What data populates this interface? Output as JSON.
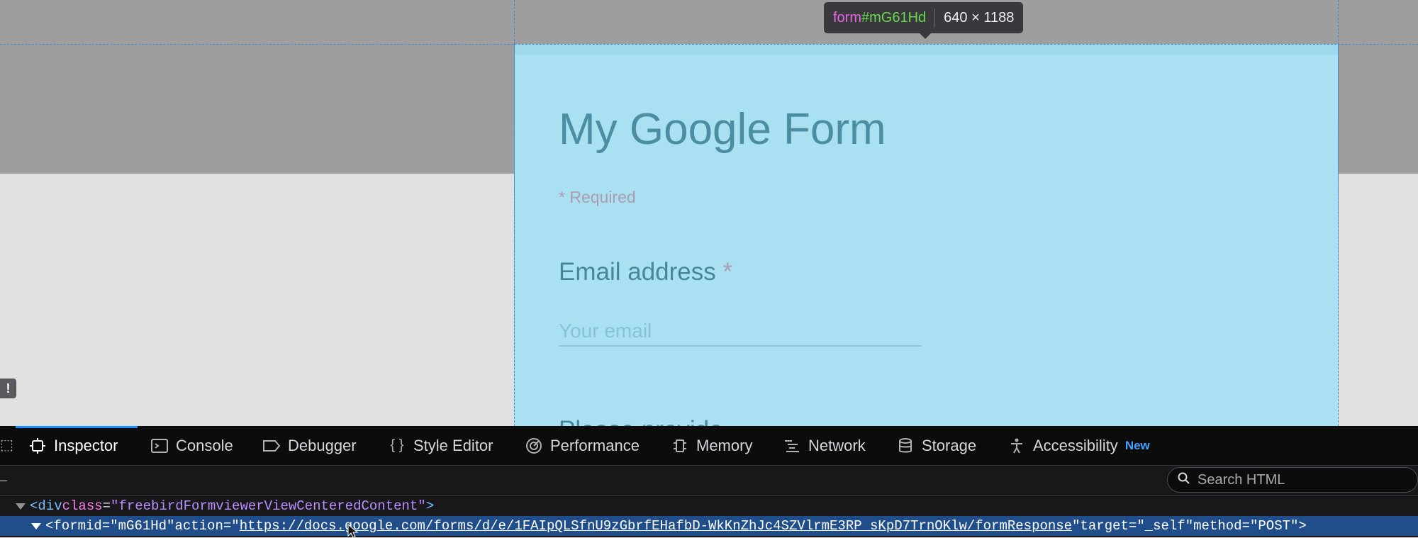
{
  "form_preview": {
    "title": "My Google Form",
    "required_note": "* Required",
    "email_label": "Email address",
    "required_star": "*",
    "email_placeholder": "Your email",
    "next_question_partial": "Please provide..."
  },
  "tooltip": {
    "tag": "form",
    "id": "#mG61Hd",
    "dimensions": "640 × 1188"
  },
  "side_badge": "!",
  "devtools": {
    "tabs": [
      {
        "label": "Inspector",
        "icon": "inspector-icon"
      },
      {
        "label": "Console",
        "icon": "console-icon"
      },
      {
        "label": "Debugger",
        "icon": "debugger-icon"
      },
      {
        "label": "Style Editor",
        "icon": "style-editor-icon"
      },
      {
        "label": "Performance",
        "icon": "performance-icon"
      },
      {
        "label": "Memory",
        "icon": "memory-icon"
      },
      {
        "label": "Network",
        "icon": "network-icon"
      },
      {
        "label": "Storage",
        "icon": "storage-icon"
      },
      {
        "label": "Accessibility",
        "icon": "accessibility-icon"
      }
    ],
    "accessibility_badge": "New",
    "active_tab": "Inspector",
    "search_placeholder": "Search HTML",
    "tree": {
      "line1": {
        "open": "<div ",
        "attr_name": "class",
        "eq": "=",
        "attr_value": "\"freebirdFormviewerViewCenteredContent\"",
        "close": ">"
      },
      "line2": {
        "open": "<form ",
        "id_attr": "id=",
        "id_value": "\"mG61Hd\"",
        "action_attr": " action=",
        "action_value_q": "\"",
        "action_value": "https://docs.google.com/forms/d/e/1FAIpQLSfnU9zGbrfEHafbD-WkKnZhJc4SZVlrmE3RP_sKpD7TrnOKlw/formResponse",
        "action_value_q2": "\"",
        "target_attr": " target=",
        "target_value": "\"_self\"",
        "method_attr": " method=",
        "method_value": "\"POST\"",
        "close": ">"
      }
    }
  },
  "colors": {
    "highlight": "#a9e1f3",
    "devtools_bg": "#18181a",
    "selected_row": "#204e8a",
    "accent": "#1a8cff"
  }
}
